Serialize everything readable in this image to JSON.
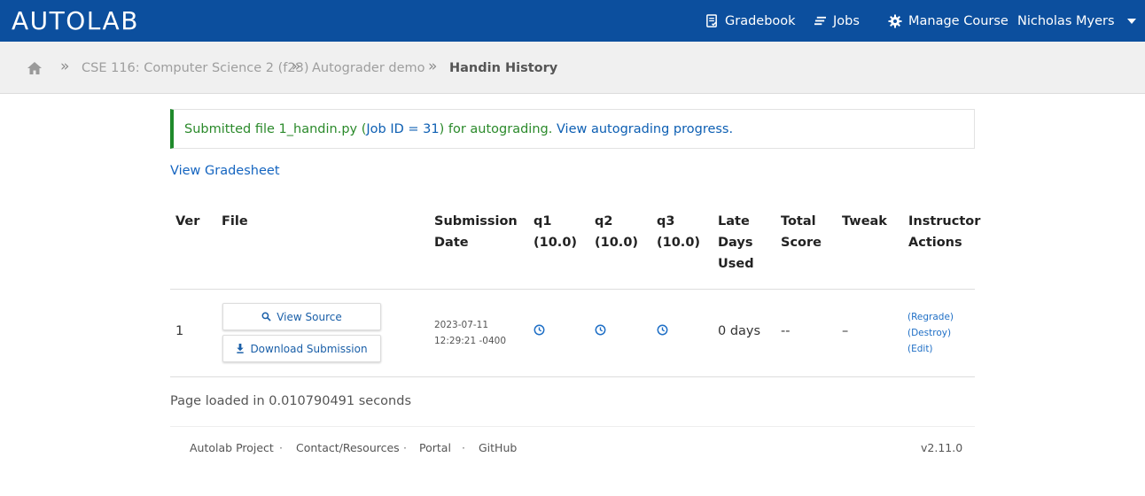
{
  "app": {
    "logo": "AUTOLAB"
  },
  "nav": {
    "gradebook": "Gradebook",
    "jobs": "Jobs",
    "manage_course": "Manage Course",
    "user": "Nicholas Myers"
  },
  "breadcrumb": {
    "separator": "»",
    "course": "CSE 116: Computer Science 2 (f23)",
    "assessment": "Autograder demo",
    "current": "Handin History"
  },
  "flash": {
    "prefix": "Submitted file 1_handin.py (",
    "job_link": "Job ID = 31",
    "middle": ") for autograding. ",
    "progress_link": "View autograding progress."
  },
  "view_gradesheet": "View Gradesheet",
  "table": {
    "headers": {
      "ver": "Ver",
      "file": "File",
      "submission_date": [
        "Submission",
        "Date"
      ],
      "q1": [
        "q1",
        "(10.0)"
      ],
      "q2": [
        "q2",
        "(10.0)"
      ],
      "q3": [
        "q3",
        "(10.0)"
      ],
      "late_days": [
        "Late",
        "Days",
        "Used"
      ],
      "total_score": [
        "Total",
        "Score"
      ],
      "tweak": "Tweak",
      "instructor_actions": [
        "Instructor",
        "Actions"
      ]
    },
    "rows": [
      {
        "ver": "1",
        "view_source": "View Source",
        "download": "Download Submission",
        "date_line1": "2023-07-11",
        "date_line2": "12:29:21 -0400",
        "late_days": "0 days",
        "total_score": "--",
        "tweak": "–",
        "actions": [
          "(Regrade)",
          "(Destroy)",
          "(Edit)"
        ]
      }
    ]
  },
  "page_loaded": "Page loaded in 0.010790491 seconds",
  "footer": {
    "links": [
      "Autolab Project",
      "Contact/Resources",
      "Portal",
      "GitHub"
    ],
    "separator": "·",
    "version": "v2.11.0"
  },
  "colors": {
    "navbar": "#0c4f9e",
    "success": "#2b8a2b",
    "link": "#1565c0"
  },
  "icons": {
    "home": "home-icon",
    "gradebook": "gradebook-icon",
    "jobs": "jobs-icon",
    "manage": "gear-icon",
    "view_source": "search-icon",
    "download": "download-icon",
    "pending": "clock-icon"
  }
}
